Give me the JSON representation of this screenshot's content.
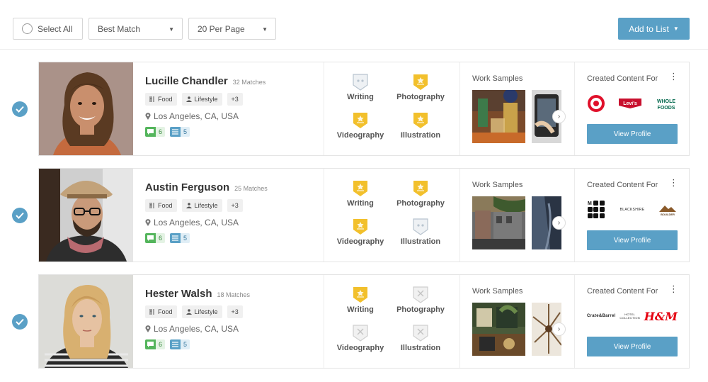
{
  "toolbar": {
    "select_all": "Select All",
    "sort": "Best Match",
    "per_page": "20 Per Page",
    "add_to_list": "Add to List"
  },
  "common": {
    "work_samples": "Work Samples",
    "created_content_for": "Created Content For",
    "view_profile": "View Profile",
    "skill_labels": [
      "Writing",
      "Photography",
      "Videography",
      "Illustration"
    ]
  },
  "colors": {
    "accent": "#5aa0c6",
    "gold": "#f2c02c",
    "green": "#54b55c"
  },
  "creators": [
    {
      "name": "Lucille Chandler",
      "matches": "32 Matches",
      "tags": [
        "Food",
        "Lifestyle",
        "+3"
      ],
      "location": "Los Angeles, CA, USA",
      "messages": "6",
      "lists": "5",
      "skills": {
        "Writing": "inactive",
        "Photography": "active",
        "Videography": "active",
        "Illustration": "active"
      },
      "brands": [
        "target",
        "levis",
        "whole-foods"
      ],
      "brand_text": {
        "levis": "Levi's",
        "whole_foods": "WHOLE FOODS"
      }
    },
    {
      "name": "Austin Ferguson",
      "matches": "25 Matches",
      "tags": [
        "Food",
        "Lifestyle",
        "+3"
      ],
      "location": "Los Angeles, CA, USA",
      "messages": "6",
      "lists": "5",
      "skills": {
        "Writing": "active",
        "Photography": "active",
        "Videography": "active",
        "Illustration": "inactive"
      },
      "brands": [
        "m-grid",
        "black-brand",
        "boulder"
      ],
      "brand_text": {
        "black": "BLACKSHIRE",
        "boulder": "BOULDER"
      }
    },
    {
      "name": "Hester Walsh",
      "matches": "18 Matches",
      "tags": [
        "Food",
        "Lifestyle",
        "+3"
      ],
      "location": "Los Angeles, CA, USA",
      "messages": "6",
      "lists": "5",
      "skills": {
        "Writing": "active",
        "Photography": "disabled",
        "Videography": "disabled",
        "Illustration": "disabled"
      },
      "brands": [
        "crate-barrel",
        "hotel",
        "hm"
      ],
      "brand_text": {
        "crate": "Crate&Barrel",
        "hotel": "HOTEL COLLECTION",
        "hm": "H&M"
      }
    }
  ]
}
